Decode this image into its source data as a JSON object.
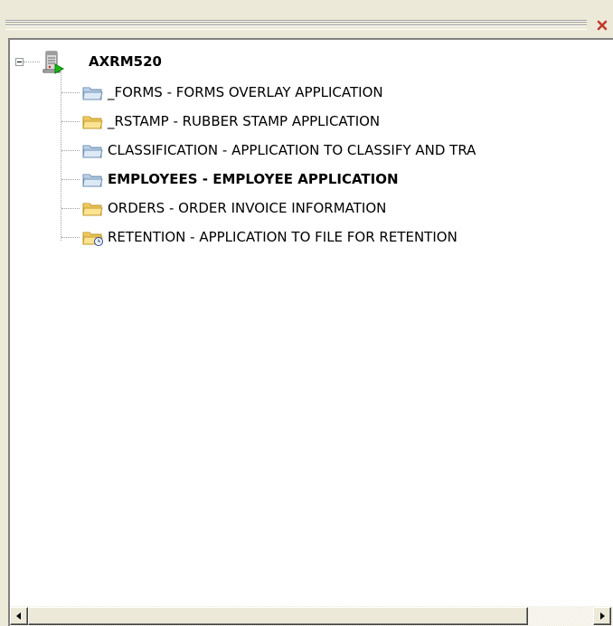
{
  "pane": {
    "close_icon": "close-icon"
  },
  "tree": {
    "root": {
      "label": "AXRM520",
      "icon": "server-icon",
      "expanded": true
    },
    "items": [
      {
        "label": "_FORMS - FORMS OVERLAY APPLICATION",
        "icon": "blue-folder-icon",
        "bold": false
      },
      {
        "label": "_RSTAMP - RUBBER STAMP APPLICATION",
        "icon": "yellow-folder-icon",
        "bold": false
      },
      {
        "label": "CLASSIFICATION - APPLICATION TO CLASSIFY AND TRA",
        "icon": "blue-folder-icon",
        "bold": false
      },
      {
        "label": "EMPLOYEES - EMPLOYEE APPLICATION",
        "icon": "blue-folder-icon",
        "bold": true
      },
      {
        "label": "ORDERS - ORDER INVOICE INFORMATION",
        "icon": "yellow-folder-icon",
        "bold": false
      },
      {
        "label": "RETENTION - APPLICATION TO FILE FOR RETENTION",
        "icon": "yellow-folder-clock-icon",
        "bold": false
      }
    ]
  },
  "scrollbar": {
    "left_icon": "arrow-left-icon",
    "right_icon": "arrow-right-icon"
  },
  "colors": {
    "window_bg": "#ece9d8",
    "tree_bg": "#ffffff",
    "yellow_folder": "#f5d36a",
    "blue_folder": "#c9dcee"
  }
}
